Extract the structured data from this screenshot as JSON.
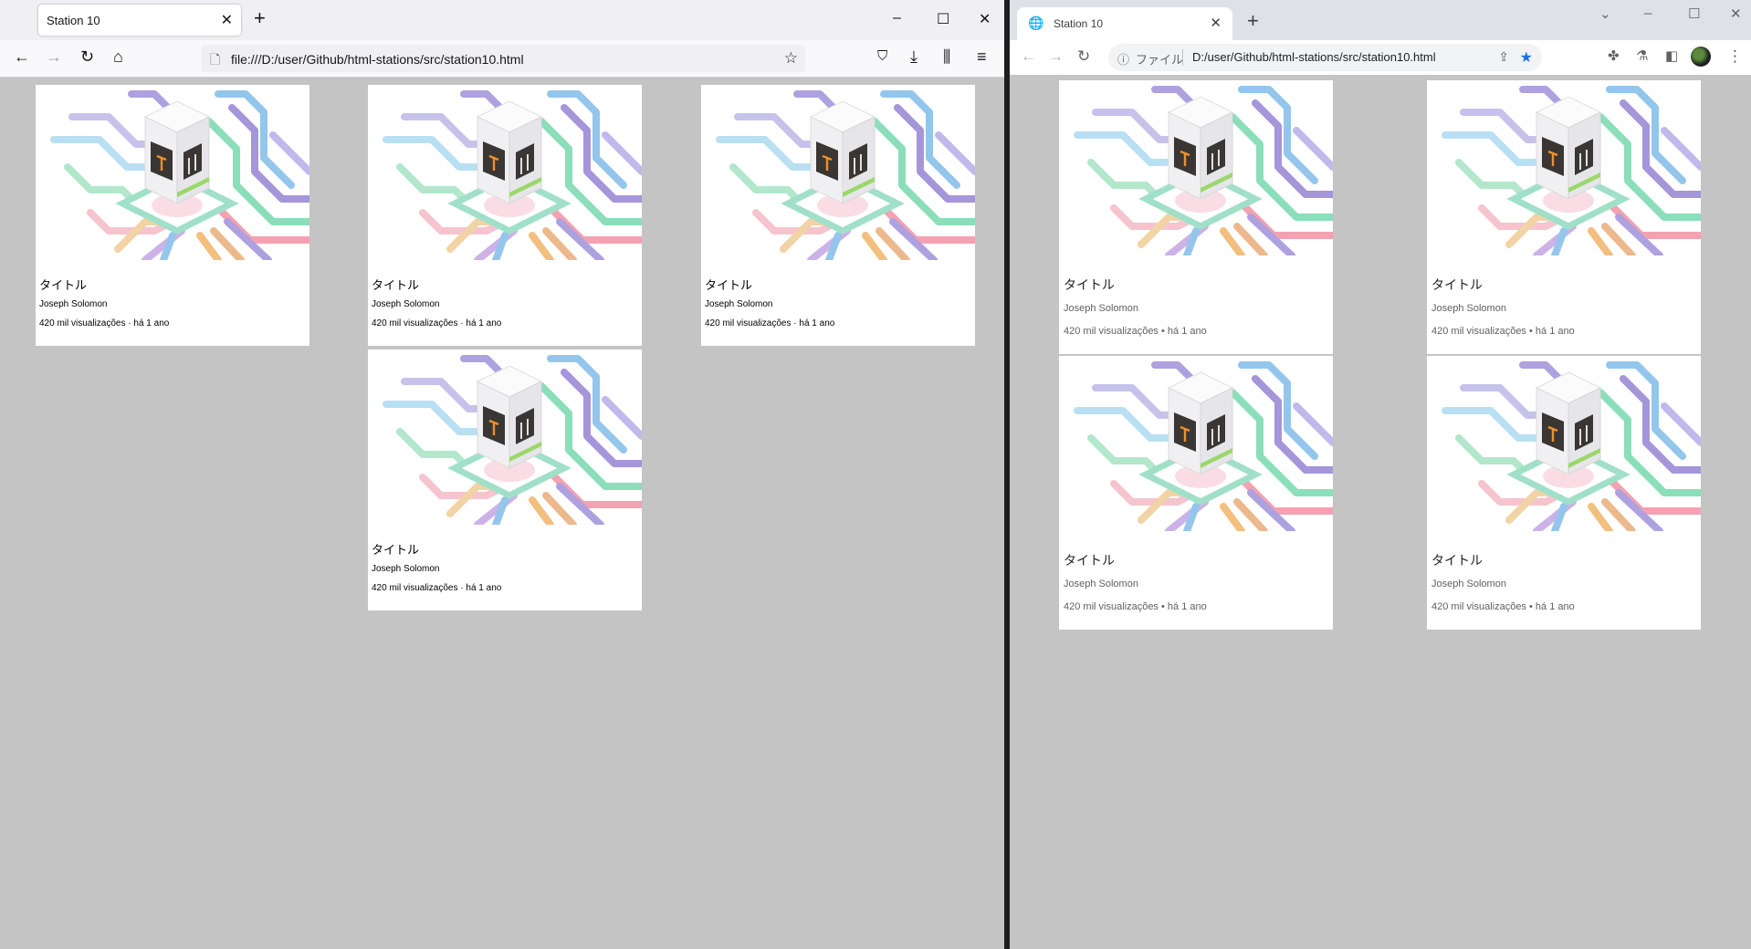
{
  "firefox": {
    "tab_title": "Station 10",
    "url": "file:///D:/user/Github/html-stations/src/station10.html"
  },
  "chrome": {
    "tab_title": "Station 10",
    "url_label": "ファイル",
    "url": "D:/user/Github/html-stations/src/station10.html"
  },
  "card": {
    "title": "タイトル",
    "author": "Joseph Solomon",
    "views": "420 mil visualizações",
    "separator_ff": "·",
    "separator_cr": "•",
    "age": "há 1 ano"
  },
  "icons": {
    "close": "✕",
    "plus": "+",
    "back": "←",
    "forward": "→",
    "reload": "↻",
    "home": "⌂",
    "page": "🗋",
    "star": "☆",
    "star_filled": "★",
    "info": "ⓘ",
    "globe": "🌐",
    "share": "⇪",
    "pocket": "⛉",
    "download": "⤓",
    "library": "⫼",
    "menu": "≡",
    "minimize": "–",
    "maximize": "☐",
    "chevron": "⌄",
    "puzzle": "✤",
    "flask": "⚗",
    "sidepanel": "◧",
    "kebab": "⋮"
  },
  "colors": {
    "page_background": "#c4c4c4",
    "card_background": "#ffffff",
    "chrome_accent": "#1a73e8"
  }
}
